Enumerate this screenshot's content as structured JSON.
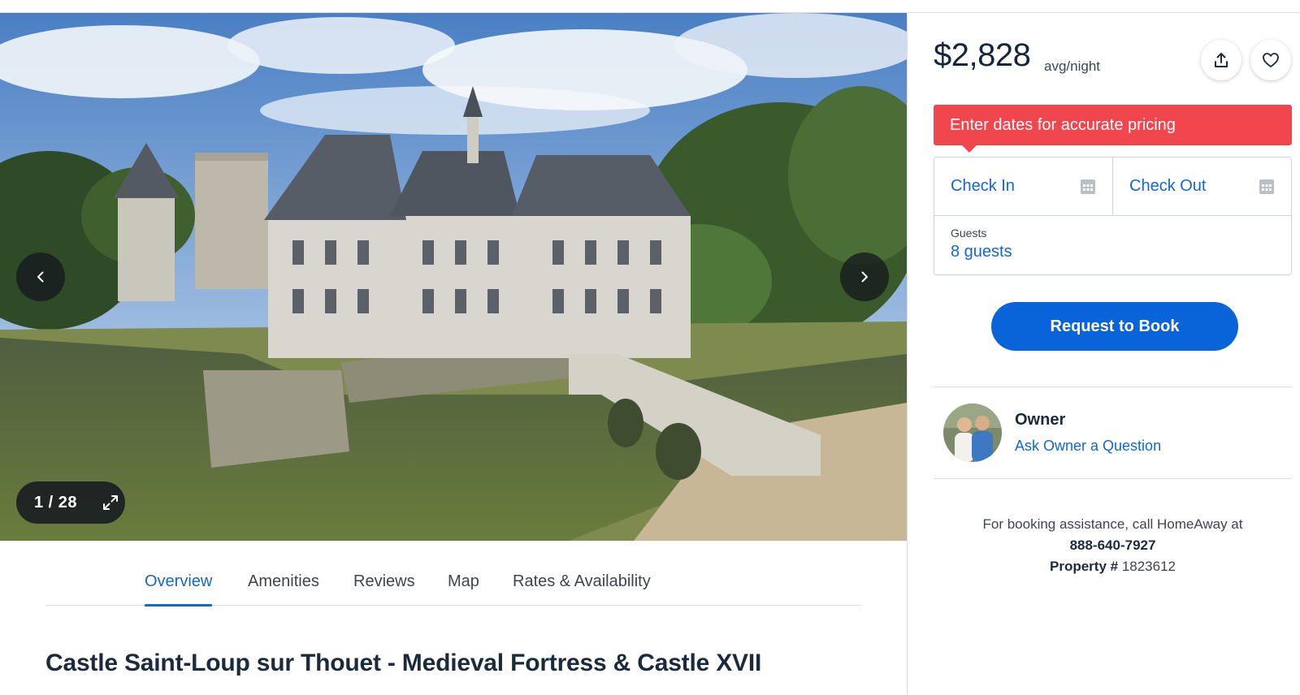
{
  "gallery": {
    "counter": "1 / 28",
    "icons": {
      "prev": "chevron-left-icon",
      "next": "chevron-right-icon",
      "expand": "expand-icon"
    }
  },
  "tabs": [
    {
      "label": "Overview",
      "active": true
    },
    {
      "label": "Amenities",
      "active": false
    },
    {
      "label": "Reviews",
      "active": false
    },
    {
      "label": "Map",
      "active": false
    },
    {
      "label": "Rates & Availability",
      "active": false
    }
  ],
  "listing": {
    "title": "Castle Saint-Loup sur Thouet - Medieval Fortress & Castle XVII"
  },
  "booking": {
    "price": "$2,828",
    "price_unit": "avg/night",
    "alert": "Enter dates for accurate pricing",
    "check_in": "Check In",
    "check_out": "Check Out",
    "guests_label": "Guests",
    "guests_value": "8 guests",
    "request_button": "Request to Book",
    "icons": {
      "share": "share-icon",
      "favorite": "heart-icon",
      "calendar": "calendar-icon"
    }
  },
  "owner": {
    "label": "Owner",
    "link": "Ask Owner a Question"
  },
  "assistance": {
    "text": "For booking assistance, call HomeAway at",
    "phone": "888-640-7927",
    "property_label": "Property #",
    "property_number": "1823612"
  },
  "colors": {
    "accent": "#1466d6",
    "button": "#0a64d9",
    "alert": "#f2464e",
    "text": "#1c2b3c"
  }
}
